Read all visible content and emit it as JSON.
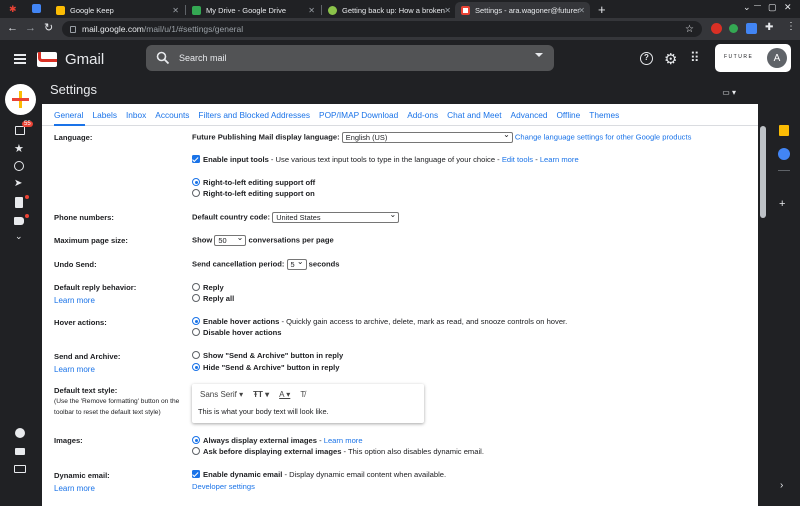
{
  "browser": {
    "tabs": [
      {
        "title": "Google Keep",
        "favicon_color": "#fbbc04"
      },
      {
        "title": "My Drive - Google Drive",
        "favicon_color": "#34a853"
      },
      {
        "title": "Getting back up: How a broken C",
        "favicon_color": "#8bc34a"
      },
      {
        "title": "Settings - ara.wagoner@futurene",
        "favicon_color": "#ea4335"
      }
    ],
    "new_tab": "+",
    "window_controls": [
      "⌄",
      "—",
      "▢",
      "✕"
    ],
    "url_host": "mail.google.com",
    "url_path": "/mail/u/1/#settings/general"
  },
  "gmail": {
    "brand": "Gmail",
    "search_placeholder": "Search mail",
    "account_logo": "FUTURE",
    "avatar_letter": "A",
    "unread_badge": "55"
  },
  "settings": {
    "title": "Settings",
    "tabs": [
      "General",
      "Labels",
      "Inbox",
      "Accounts",
      "Filters and Blocked Addresses",
      "POP/IMAP Download",
      "Add-ons",
      "Chat and Meet",
      "Advanced",
      "Offline",
      "Themes"
    ],
    "language": {
      "label": "Language:",
      "display_label": "Future Publishing Mail display language:",
      "value": "English (US)",
      "change_link": "Change language settings for other Google products",
      "input_tools_bold": "Enable input tools",
      "input_tools_text": " - Use various text input tools to type in the language of your choice - ",
      "edit_tools": "Edit tools",
      "sep": " - ",
      "learn_more": "Learn more",
      "rtl_off": "Right-to-left editing support off",
      "rtl_on": "Right-to-left editing support on"
    },
    "phone": {
      "label": "Phone numbers:",
      "field": "Default country code:",
      "value": "United States"
    },
    "page_size": {
      "label": "Maximum page size:",
      "show": "Show",
      "value": "50",
      "suffix": "conversations per page"
    },
    "undo": {
      "label": "Undo Send:",
      "field": "Send cancellation period:",
      "value": "5",
      "suffix": "seconds"
    },
    "reply": {
      "label": "Default reply behavior:",
      "learn_more": "Learn more",
      "opt1": "Reply",
      "opt2": "Reply all"
    },
    "hover": {
      "label": "Hover actions:",
      "opt1_bold": "Enable hover actions",
      "opt1_text": " - Quickly gain access to archive, delete, mark as read, and snooze controls on hover.",
      "opt2": "Disable hover actions"
    },
    "send_archive": {
      "label": "Send and Archive:",
      "learn_more": "Learn more",
      "opt1": "Show \"Send & Archive\" button in reply",
      "opt2": "Hide \"Send & Archive\" button in reply"
    },
    "text_style": {
      "label": "Default text style:",
      "note_line1": "(Use the 'Remove formatting' button on the",
      "note_line2": "toolbar to reset the default text style)",
      "font": "Sans Serif",
      "preview": "This is what your body text will look like."
    },
    "images": {
      "label": "Images:",
      "opt1_bold": "Always display external images",
      "opt1_sep": " - ",
      "learn_more": "Learn more",
      "opt2_bold": "Ask before displaying external images",
      "opt2_text": " - This option also disables dynamic email."
    },
    "dynamic": {
      "label": "Dynamic email:",
      "learn_more": "Learn more",
      "opt_bold": "Enable dynamic email",
      "opt_text": " - Display dynamic email content when available.",
      "dev_settings": "Developer settings"
    }
  }
}
